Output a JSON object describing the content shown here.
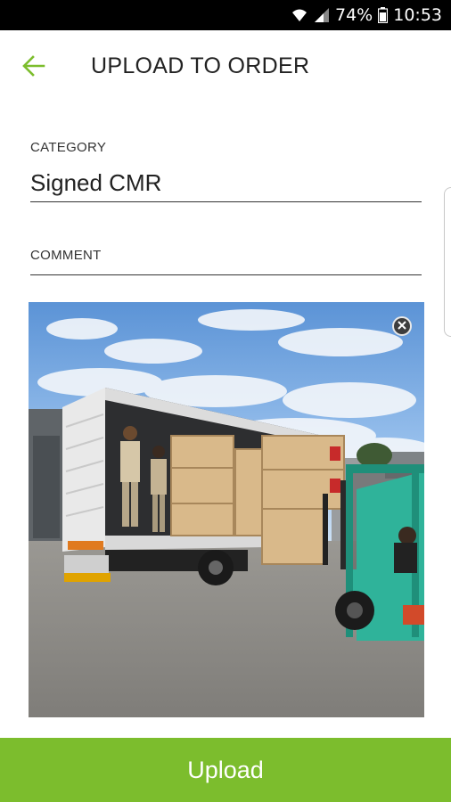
{
  "status_bar": {
    "battery": "74%",
    "time": "10:53",
    "icons": [
      "wifi-icon",
      "signal-icon",
      "battery-icon"
    ]
  },
  "app_bar": {
    "title": "UPLOAD TO ORDER",
    "back_icon": "arrow-left-icon"
  },
  "form": {
    "category": {
      "label": "CATEGORY",
      "value": "Signed CMR"
    },
    "comment": {
      "label": "COMMENT",
      "value": ""
    }
  },
  "attachment": {
    "description_icon": "photo-thumbnail",
    "remove_icon": "close-icon"
  },
  "actions": {
    "upload_label": "Upload"
  },
  "colors": {
    "accent": "#7cbd2d",
    "text": "#222222",
    "status_bar": "#000000"
  }
}
